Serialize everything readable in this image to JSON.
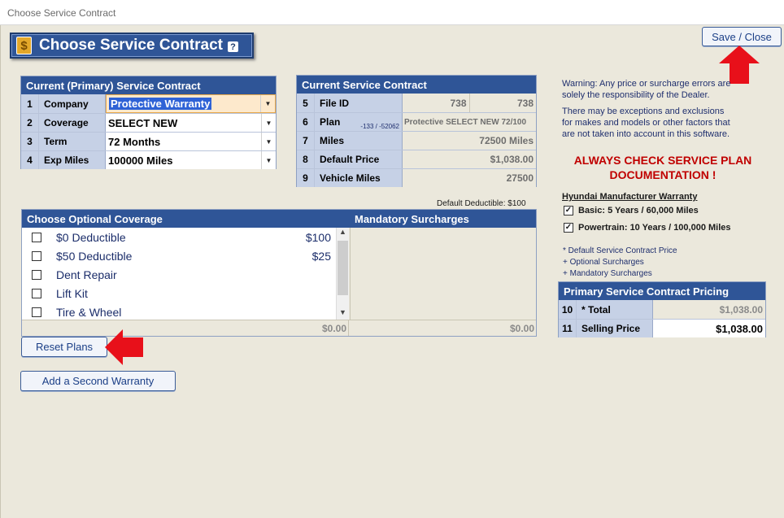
{
  "window": {
    "title": "Choose Service Contract"
  },
  "header": {
    "title": "Choose Service Contract",
    "help": "?"
  },
  "save_close": {
    "label": "Save / Close"
  },
  "primary": {
    "title": "Current (Primary) Service Contract",
    "rows": [
      {
        "num": "1",
        "label": "Company",
        "value": "Protective Warranty"
      },
      {
        "num": "2",
        "label": "Coverage",
        "value": "SELECT NEW"
      },
      {
        "num": "3",
        "label": "Term",
        "value": "72 Months"
      },
      {
        "num": "4",
        "label": "Exp Miles",
        "value": "100000 Miles"
      }
    ]
  },
  "current": {
    "title": "Current Service Contract",
    "file_id": {
      "num": "5",
      "label": "File ID",
      "value_a": "738",
      "value_b": "738"
    },
    "plan": {
      "num": "6",
      "label": "Plan",
      "sub": "-133 / -52062",
      "value": "Protective SELECT NEW 72/100"
    },
    "miles": {
      "num": "7",
      "label": "Miles",
      "value": "72500 Miles"
    },
    "default_price": {
      "num": "8",
      "label": "Default Price",
      "value": "$1,038.00"
    },
    "vehicle_miles": {
      "num": "9",
      "label": "Vehicle Miles",
      "value": "27500"
    }
  },
  "default_deductible": "Default Deductible: $100",
  "optional": {
    "title": "Choose Optional Coverage",
    "items": [
      {
        "label": "$0 Deductible",
        "price": "$100"
      },
      {
        "label": "$50 Deductible",
        "price": "$25"
      },
      {
        "label": "Dent Repair",
        "price": ""
      },
      {
        "label": "Lift Kit",
        "price": ""
      },
      {
        "label": "Tire & Wheel",
        "price": ""
      }
    ],
    "total": "$0.00"
  },
  "mandatory": {
    "title": "Mandatory Surcharges",
    "total": "$0.00"
  },
  "reset": {
    "label": "Reset Plans"
  },
  "add_second": {
    "label": "Add a Second Warranty"
  },
  "warning": {
    "line1": "Warning:  Any price or surcharge errors are",
    "line2": "solely the responsibility of the Dealer.",
    "line3": "There may be exceptions and exclusions",
    "line4": "for makes and models or other factors that",
    "line5": "are not taken into account in this software."
  },
  "always": {
    "line1": "ALWAYS CHECK SERVICE PLAN",
    "line2": "DOCUMENTATION !"
  },
  "manufacturer": {
    "title": "Hyundai Manufacturer Warranty",
    "basic": "Basic: 5 Years / 60,000 Miles",
    "powertrain": "Powertrain: 10 Years / 100,000 Miles"
  },
  "notes": {
    "n1": "* Default Service Contract Price",
    "n2": "+ Optional Surcharges",
    "n3": "+ Mandatory Surcharges"
  },
  "pricing": {
    "title": "Primary Service Contract Pricing",
    "total": {
      "num": "10",
      "label": "* Total",
      "value": "$1,038.00"
    },
    "selling": {
      "num": "11",
      "label": "Selling Price",
      "value": "$1,038.00"
    }
  },
  "colors": {
    "header_blue": "#2f5597",
    "background": "#ebe8dc",
    "warning_red": "#c00000",
    "arrow_red": "#e8101a"
  }
}
